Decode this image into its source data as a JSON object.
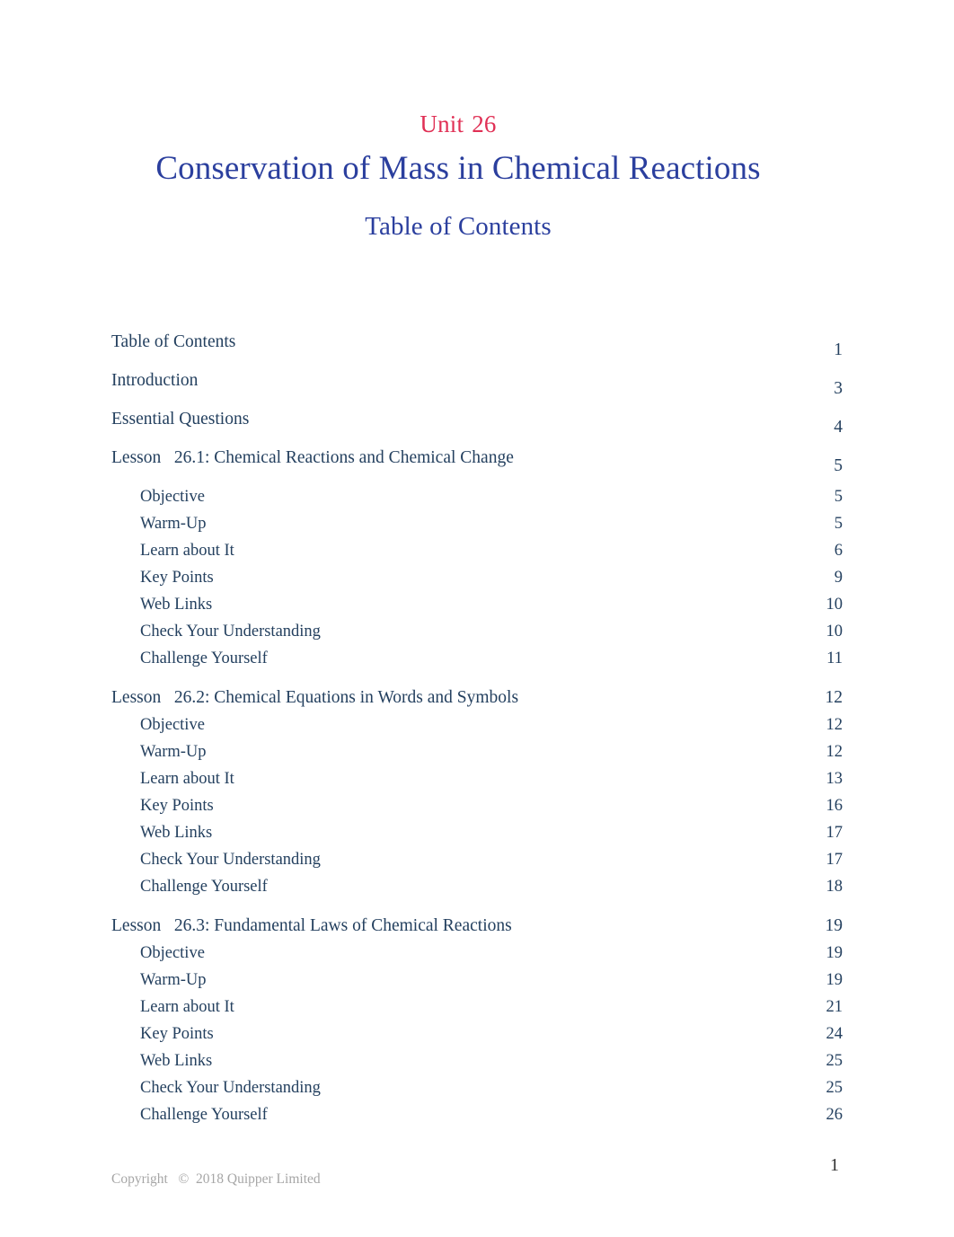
{
  "document": {
    "unit_label": "Unit",
    "unit_number": "26",
    "title": "Conservation of Mass in Chemical Reactions",
    "section_heading": "Table of Contents"
  },
  "colors": {
    "unit_red": "#e03055",
    "title_blue": "#2b3f9e",
    "entry_navy": "#24405f",
    "copyright_gray": "#a6a6a6",
    "page_number_dark": "#2e2e2e",
    "background": "#ffffff"
  },
  "toc": {
    "entries": [
      {
        "label": "Table of Contents",
        "page": "1",
        "level": 1,
        "style": "loose",
        "group_start": false
      },
      {
        "label": "Introduction",
        "page": "3",
        "level": 1,
        "style": "loose",
        "group_start": false
      },
      {
        "label": "Essential Questions",
        "page": "4",
        "level": 1,
        "style": "loose",
        "group_start": false
      },
      {
        "label": "Lesson   26.1: Chemical Reactions and Chemical Change",
        "page": "5",
        "level": 1,
        "style": "loose",
        "group_start": false
      },
      {
        "label": "Objective",
        "page": "5",
        "level": 2,
        "style": "tight",
        "group_start": false
      },
      {
        "label": "Warm-Up",
        "page": "5",
        "level": 2,
        "style": "tight",
        "group_start": false
      },
      {
        "label": "Learn about It",
        "page": "6",
        "level": 2,
        "style": "tight",
        "group_start": false
      },
      {
        "label": "Key Points",
        "page": "9",
        "level": 2,
        "style": "tight",
        "group_start": false
      },
      {
        "label": "Web Links",
        "page": "10",
        "level": 2,
        "style": "tight",
        "group_start": false
      },
      {
        "label": "Check Your Understanding",
        "page": "10",
        "level": 2,
        "style": "tight",
        "group_start": false
      },
      {
        "label": "Challenge Yourself",
        "page": "11",
        "level": 2,
        "style": "tight",
        "group_start": false
      },
      {
        "label": "Lesson   26.2: Chemical Equations in Words and Symbols",
        "page": "12",
        "level": 1,
        "style": "tight",
        "group_start": true
      },
      {
        "label": "Objective",
        "page": "12",
        "level": 2,
        "style": "tight",
        "group_start": false
      },
      {
        "label": "Warm-Up",
        "page": "12",
        "level": 2,
        "style": "tight",
        "group_start": false
      },
      {
        "label": "Learn about It",
        "page": "13",
        "level": 2,
        "style": "tight",
        "group_start": false
      },
      {
        "label": "Key Points",
        "page": "16",
        "level": 2,
        "style": "tight",
        "group_start": false
      },
      {
        "label": "Web Links",
        "page": "17",
        "level": 2,
        "style": "tight",
        "group_start": false
      },
      {
        "label": "Check Your Understanding",
        "page": "17",
        "level": 2,
        "style": "tight",
        "group_start": false
      },
      {
        "label": "Challenge Yourself",
        "page": "18",
        "level": 2,
        "style": "tight",
        "group_start": false
      },
      {
        "label": "Lesson   26.3: Fundamental Laws of Chemical Reactions",
        "page": "19",
        "level": 1,
        "style": "tight",
        "group_start": true
      },
      {
        "label": "Objective",
        "page": "19",
        "level": 2,
        "style": "tight",
        "group_start": false
      },
      {
        "label": "Warm-Up",
        "page": "19",
        "level": 2,
        "style": "tight",
        "group_start": false
      },
      {
        "label": "Learn about It",
        "page": "21",
        "level": 2,
        "style": "tight",
        "group_start": false
      },
      {
        "label": "Key Points",
        "page": "24",
        "level": 2,
        "style": "tight",
        "group_start": false
      },
      {
        "label": "Web Links",
        "page": "25",
        "level": 2,
        "style": "tight",
        "group_start": false
      },
      {
        "label": "Check Your Understanding",
        "page": "25",
        "level": 2,
        "style": "tight",
        "group_start": false
      },
      {
        "label": "Challenge Yourself",
        "page": "26",
        "level": 2,
        "style": "tight",
        "group_start": false
      }
    ]
  },
  "footer": {
    "copyright": "Copyright   ©  2018 Quipper Limited",
    "page_number": "1"
  }
}
